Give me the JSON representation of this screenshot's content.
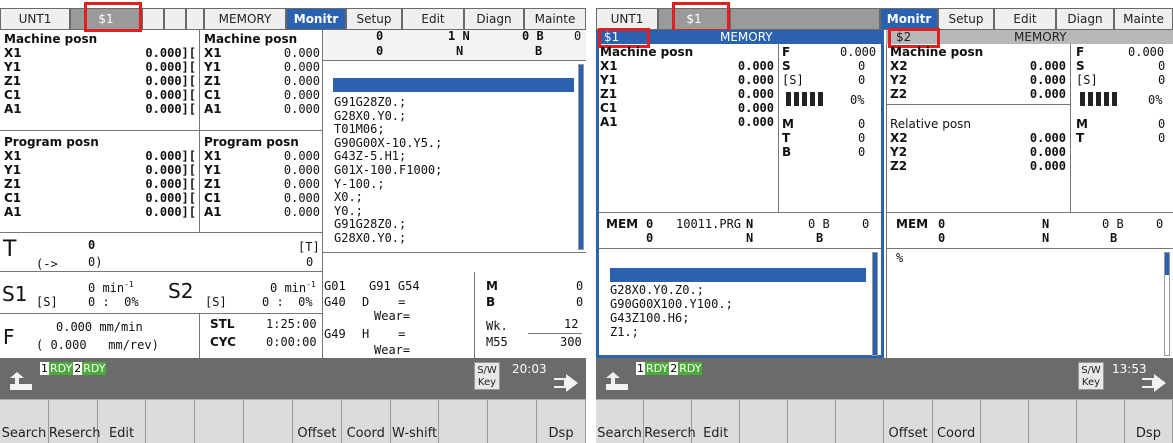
{
  "left": {
    "tabs": {
      "unit": "UNT1",
      "sys": "$1",
      "mode": "MEMORY",
      "monitor": "Monitr",
      "setup": "Setup",
      "edit": "Edit",
      "diagn": "Diagn",
      "mainte": "Mainte"
    },
    "machine_posn_title": "Machine posn",
    "program_posn_title": "Program posn",
    "axes": [
      "X1",
      "Y1",
      "Z1",
      "C1",
      "A1"
    ],
    "machine_values": [
      "0.000][",
      "0.000][",
      "0.000][",
      "0.000][",
      "0.000]["
    ],
    "program_values": [
      "0.000][",
      "0.000][",
      "0.000][",
      "0.000][",
      "0.000]["
    ],
    "machine2_values": [
      "0.000",
      "0.000",
      "0.000",
      "0.000",
      "0.000"
    ],
    "program2_values": [
      "0.000",
      "0.000",
      "0.000",
      "0.000",
      "0.000"
    ],
    "top_right": {
      "row1_o": "0",
      "row1_n": "1 N",
      "row1_b": "0 B",
      "row1_v": "0",
      "row2_o": "0",
      "row2_n": "N",
      "row2_b": "B"
    },
    "program_lines": [
      "G91G28Z0.;",
      "G28X0.Y0.;",
      "T01M06;",
      "G90G00X-10.Y5.;",
      "G43Z-5.H1;",
      "G01X-100.F1000;",
      "Y-100.;",
      "X0.;",
      "Y0.;",
      "G91G28Z0.;",
      "G28X0.Y0.;"
    ],
    "tool": {
      "t_label": "T",
      "t_val": "0",
      "t_sub": "(->",
      "t_sub_val": "0)",
      "bracket_t": "[T]",
      "bracket_val": "0"
    },
    "spindle": {
      "s1": "S1",
      "s1_rpm": "0 min",
      "s1_sup": "-1",
      "s1_s": "[S]",
      "s1_pct": "0 :  0%",
      "s2": "S2",
      "s2_rpm": "0 min",
      "s2_sup": "-1",
      "s2_s": "[S]",
      "s2_pct": "0 :  0%"
    },
    "feed": {
      "f": "F",
      "mm_min": "0.000 mm/min",
      "mm_rev": "( 0.000   mm/rev)",
      "stl": "STL",
      "stl_time": "1:25:00",
      "cyc": "CYC",
      "cyc_time": "0:00:00"
    },
    "gcodes": {
      "g01": "G01",
      "g91": "G91 G54",
      "g40": "G40",
      "d": "D    =",
      "wear1": "Wear=",
      "g49": "G49",
      "h": "H    =",
      "wear2": "Wear="
    },
    "mbm": {
      "m": "M",
      "b": "B",
      "m_val": "0",
      "b_val": "0",
      "wk": "Wk.",
      "wk_val": "12",
      "m55": "M55",
      "m55_val": "300"
    },
    "status": {
      "rdy1n": "1",
      "rdy1": "RDY",
      "rdy2n": "2",
      "rdy2": "RDY",
      "sw": "S/W\nKey",
      "clock": "20:03"
    },
    "fkeys": [
      "Search",
      "Reserch",
      "Edit",
      "",
      "",
      "",
      "Offset",
      "Coord",
      "W-shift",
      "",
      "",
      "Dsp sw."
    ]
  },
  "right": {
    "tabs": {
      "unit": "UNT1",
      "sys": "$1",
      "monitor": "Monitr",
      "setup": "Setup",
      "edit": "Edit",
      "diagn": "Diagn",
      "mainte": "Mainte"
    },
    "p1": {
      "sys": "$1",
      "mode": "MEMORY",
      "title": "Machine posn",
      "axes": [
        "X1",
        "Y1",
        "Z1",
        "C1",
        "A1"
      ],
      "values": [
        "0.000",
        "0.000",
        "0.000",
        "0.000",
        "0.000"
      ],
      "f": "F",
      "f_val": "0.000",
      "s": "S",
      "s_val": "0",
      "ss": "[S]",
      "ss_val": "0",
      "pct": "0%",
      "m": "M",
      "m_val": "0",
      "t": "T",
      "t_val": "0",
      "b": "B",
      "b_val": "0",
      "mem": "MEM",
      "mem_o": "0",
      "prog": "10011.PRG",
      "n": "N",
      "b2": "0 B",
      "b2v": "0",
      "row2_o": "0",
      "row2_n": "N",
      "row2_b": "B",
      "lines": [
        "G28X0.Y0.Z0.;",
        "G90G00X100.Y100.;",
        "G43Z100.H6;",
        "Z1.;"
      ]
    },
    "p2": {
      "sys": "$2",
      "mode": "MEMORY",
      "title": "Machine posn",
      "axes": [
        "X2",
        "Y2",
        "Z2"
      ],
      "values": [
        "0.000",
        "0.000",
        "0.000"
      ],
      "rel_title": "Relative posn",
      "rel_axes": [
        "X2",
        "Y2",
        "Z2"
      ],
      "rel_values": [
        "0.000",
        "0.000",
        "0.000"
      ],
      "f": "F",
      "f_val": "0.000",
      "s": "S",
      "s_val": "0",
      "ss": "[S]",
      "ss_val": "0",
      "pct": "0%",
      "m": "M",
      "m_val": "0",
      "t": "T",
      "t_val": "0",
      "mem": "MEM",
      "mem_o": "0",
      "n": "N",
      "b2": "0 B",
      "b2v": "0",
      "row2_o": "0",
      "row2_n": "N",
      "row2_b": "B",
      "pct_sign": "%"
    },
    "status": {
      "rdy1n": "1",
      "rdy1": "RDY",
      "rdy2n": "2",
      "rdy2": "RDY",
      "sw": "S/W\nKey",
      "clock": "13:53"
    },
    "fkeys": [
      "Search",
      "Reserch",
      "Edit",
      "",
      "",
      "",
      "Offset",
      "Coord",
      "",
      "",
      "",
      "Dsp sw."
    ]
  }
}
